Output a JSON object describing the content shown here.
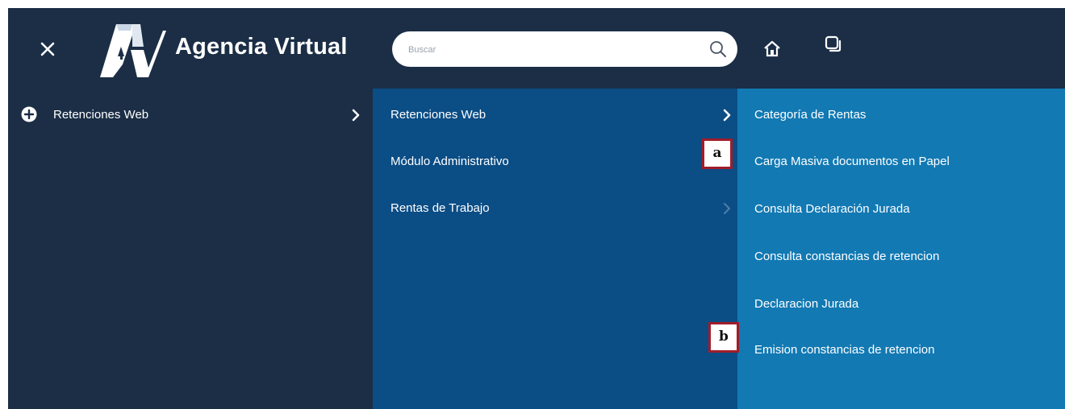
{
  "header": {
    "brand": "Agencia Virtual",
    "search_placeholder": "Buscar",
    "icons": [
      "close-icon",
      "logo-av-icon",
      "search-icon",
      "home-icon",
      "windows-icon"
    ]
  },
  "menu": {
    "level1": [
      {
        "label": "Retenciones Web",
        "icon": "plus-circle-icon",
        "has_submenu": true
      }
    ],
    "level2": [
      {
        "label": "Retenciones Web",
        "has_submenu": true,
        "active": true
      },
      {
        "label": "Módulo Administrativo",
        "has_submenu": false
      },
      {
        "label": "Rentas de Trabajo",
        "has_submenu": true,
        "active": false
      }
    ],
    "level3": [
      {
        "label": "Categoría de Rentas"
      },
      {
        "label": "Carga Masiva documentos en Papel"
      },
      {
        "label": "Consulta Declaración Jurada"
      },
      {
        "label": "Consulta constancias de retencion"
      },
      {
        "label": "Declaracion Jurada"
      },
      {
        "label": "Emision constancias de retencion"
      }
    ]
  },
  "annotations": [
    {
      "label": "a"
    },
    {
      "label": "b"
    }
  ],
  "colors": {
    "header_bg": "#1b2e46",
    "level1_bg": "#1b2e46",
    "level2_bg": "#0b4d85",
    "level3_bg": "#1279b3",
    "marker_border": "#a11d2a",
    "text": "#ffffff"
  }
}
